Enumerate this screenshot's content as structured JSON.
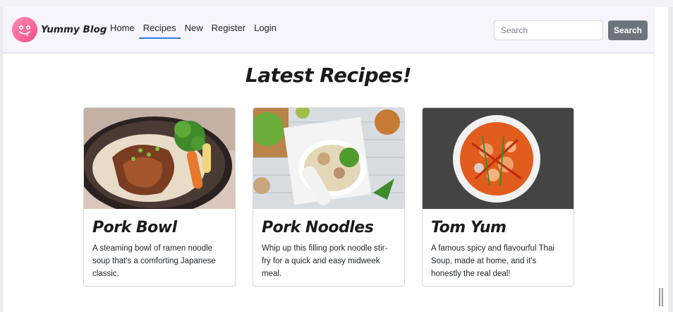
{
  "brand": {
    "name": "Yummy Blog",
    "logo_icon": "smiley-face-icon"
  },
  "nav": {
    "items": [
      {
        "label": "Home",
        "active": false
      },
      {
        "label": "Recipes",
        "active": true
      },
      {
        "label": "New",
        "active": false
      },
      {
        "label": "Register",
        "active": false
      },
      {
        "label": "Login",
        "active": false
      }
    ]
  },
  "search": {
    "placeholder": "Search",
    "button_label": "Search"
  },
  "main": {
    "heading": "Latest Recipes!",
    "cards": [
      {
        "title": "Pork Bowl",
        "description": "A steaming bowl of ramen noodle soup that's a comforting Japanese classic."
      },
      {
        "title": "Pork Noodles",
        "description": "Whip up this filling pork noodle stir-fry for a quick and easy midweek meal."
      },
      {
        "title": "Tom Yum",
        "description": "A famous spicy and flavourful Thai Soup, made at home, and it's honestly the real deal!"
      }
    ]
  },
  "colors": {
    "accent": "#2f7de1",
    "navbar_bg": "#f6f4fd",
    "search_button": "#6c757d",
    "logo": "#f24c87"
  }
}
